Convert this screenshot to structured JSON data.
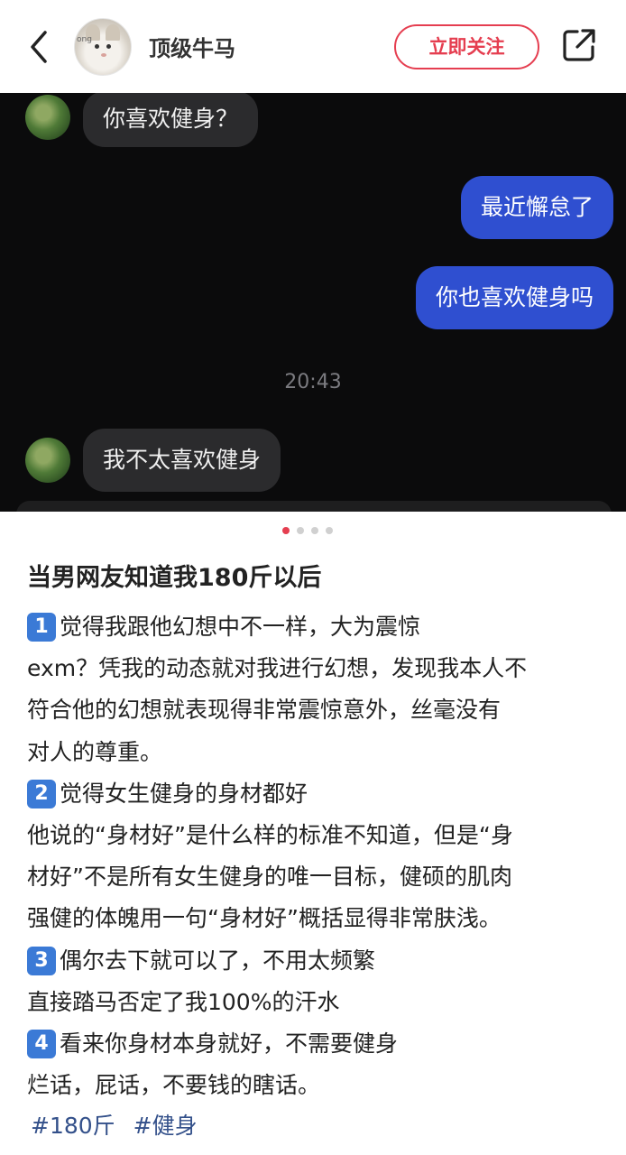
{
  "header": {
    "username": "顶级牛马",
    "avatar_label": "ong",
    "follow_label": "立即关注"
  },
  "chat": {
    "messages": [
      {
        "side": "left",
        "text": "你喜欢健身？"
      },
      {
        "side": "right",
        "text": "最近懈怠了"
      },
      {
        "side": "right",
        "text": "你也喜欢健身吗"
      },
      {
        "side": "left",
        "text": "我不太喜欢健身"
      }
    ],
    "timestamp": "20:43"
  },
  "pager": {
    "total": 4,
    "current": 1
  },
  "post": {
    "title": "当男网友知道我180斤以后",
    "lines": [
      {
        "num": "1",
        "text": "觉得我跟他幻想中不一样，大为震惊"
      },
      {
        "text": "exm？凭我的动态就对我进行幻想，发现我本人不"
      },
      {
        "text": "符合他的幻想就表现得非常震惊意外，丝毫没有"
      },
      {
        "text": "对人的尊重。"
      },
      {
        "num": "2",
        "text": "觉得女生健身的身材都好"
      },
      {
        "text": "他说的“身材好”是什么样的标准不知道，但是“身"
      },
      {
        "text": "材好”不是所有女生健身的唯一目标，健硕的肌肉"
      },
      {
        "text": "强健的体魄用一句“身材好”概括显得非常肤浅。"
      },
      {
        "num": "3",
        "text": "偶尔去下就可以了，不用太频繁"
      },
      {
        "text": "直接踏马否定了我100%的汗水"
      },
      {
        "num": "4",
        "text": "看来你身材本身就好，不需要健身"
      },
      {
        "text": "烂话，屁话，不要钱的瞎话。"
      }
    ],
    "tags": [
      "#180斤",
      "#健身"
    ]
  },
  "colors": {
    "accent": "#e53e50",
    "chat_bg": "#0b0b0c",
    "bubble_left": "#2b2b2d",
    "bubble_right": "#2f4fd0",
    "tag": "#33508a",
    "num_badge": "#3b7ad6"
  },
  "icons": {
    "back": "chevron-left-icon",
    "share": "share-icon"
  }
}
